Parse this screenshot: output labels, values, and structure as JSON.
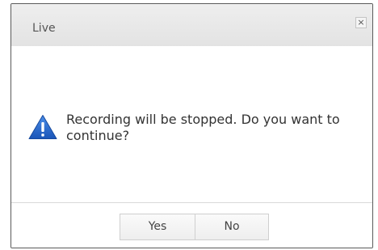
{
  "dialog": {
    "title": "Live",
    "close_label": "×",
    "icon": "warning-triangle-icon",
    "message": "Recording will be stopped. Do you want to continue?",
    "buttons": {
      "yes_label": "Yes",
      "no_label": "No"
    }
  },
  "colors": {
    "icon_blue": "#1f5fbf",
    "titlebar": "#e6e6e6",
    "border": "#5a5a5a"
  }
}
